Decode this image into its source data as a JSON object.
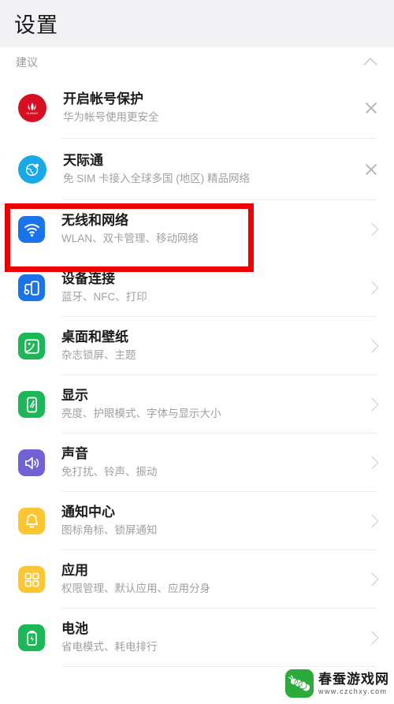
{
  "header": {
    "title": "设置"
  },
  "suggestions_section": {
    "label": "建议",
    "collapse_icon": "chevron-up-icon",
    "items": [
      {
        "icon": "huawei-logo-icon",
        "icon_color": "#d70f23",
        "title": "开启帐号保护",
        "subtitle": "华为帐号使用更安全",
        "dismiss_icon": "close-icon"
      },
      {
        "icon": "skytone-globe-icon",
        "icon_color": "#18a9e6",
        "title": "天际通",
        "subtitle": "免 SIM 卡接入全球多国 (地区) 精品网络",
        "dismiss_icon": "close-icon"
      }
    ]
  },
  "settings_list": {
    "chevron_icon": "chevron-right-icon",
    "items": [
      {
        "icon": "wifi-icon",
        "icon_color": "#1a73e8",
        "title": "无线和网络",
        "subtitle": "WLAN、双卡管理、移动网络",
        "highlighted": true
      },
      {
        "icon": "device-connect-icon",
        "icon_color": "#1a73e8",
        "title": "设备连接",
        "subtitle": "蓝牙、NFC、打印",
        "highlighted": false
      },
      {
        "icon": "wallpaper-icon",
        "icon_color": "#1cb759",
        "title": "桌面和壁纸",
        "subtitle": "杂志锁屏、主题",
        "highlighted": false
      },
      {
        "icon": "display-icon",
        "icon_color": "#1cb759",
        "title": "显示",
        "subtitle": "亮度、护眼模式、字体与显示大小",
        "highlighted": false
      },
      {
        "icon": "sound-icon",
        "icon_color": "#7061d6",
        "title": "声音",
        "subtitle": "免打扰、铃声、振动",
        "highlighted": false
      },
      {
        "icon": "bell-icon",
        "icon_color": "#fcc633",
        "title": "通知中心",
        "subtitle": "图标角标、锁屏通知",
        "highlighted": false
      },
      {
        "icon": "apps-grid-icon",
        "icon_color": "#fcc633",
        "title": "应用",
        "subtitle": "权限管理、默认应用、应用分身",
        "highlighted": false
      },
      {
        "icon": "battery-icon",
        "icon_color": "#1cb759",
        "title": "电池",
        "subtitle": "省电模式、耗电排行",
        "highlighted": false
      }
    ]
  },
  "highlight": {
    "color": "#ee0000",
    "target": "无线和网络"
  },
  "watermark": {
    "logo_icon": "silkworm-logo-icon",
    "logo_color": "#2cab3c",
    "title": "春蚕游戏网",
    "url": "www.czchxy.com"
  }
}
